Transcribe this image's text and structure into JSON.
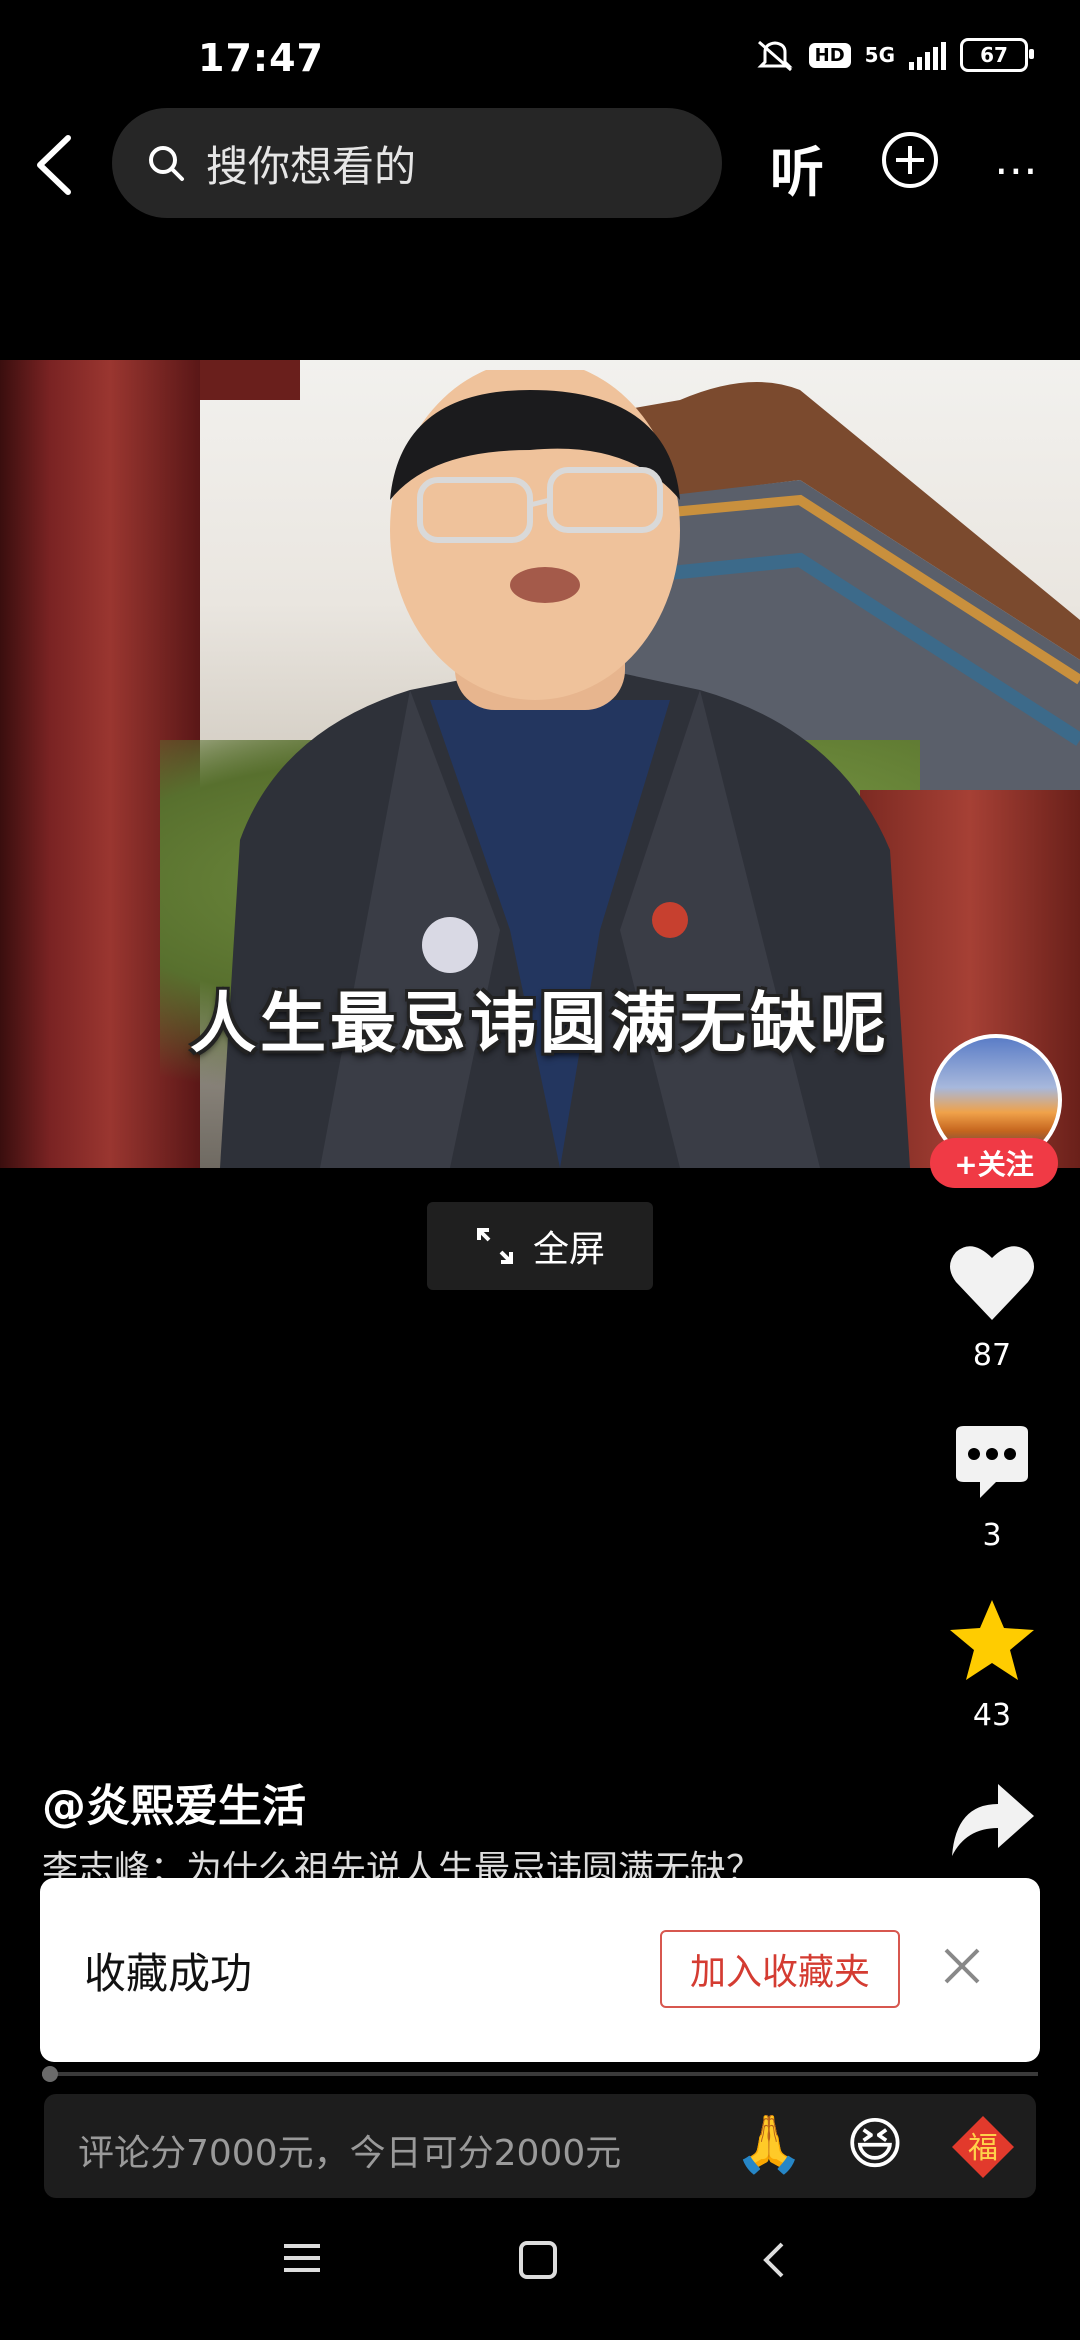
{
  "status": {
    "time": "17:47",
    "network": "5G",
    "hd": "HD",
    "battery": "67"
  },
  "search": {
    "placeholder": "搜你想看的"
  },
  "header": {
    "listen_label": "听"
  },
  "video": {
    "subtitle": "人生最忌讳圆满无缺呢",
    "fullscreen_label": "全屏"
  },
  "creator": {
    "follow_label": "+关注",
    "handle": "@炎熙爱生活"
  },
  "stats": {
    "likes": "87",
    "comments": "3",
    "favorites": "43"
  },
  "description": "李志峰：为什么祖先说人生最忌讳圆满无缺？",
  "toast": {
    "label": "收藏成功",
    "add_to_folder": "加入收藏夹"
  },
  "comment_bar": {
    "placeholder": "评论分7000元，今日可分2000元",
    "emojis": [
      "🙏",
      "😆"
    ],
    "fu_char": "福"
  },
  "colors": {
    "accent_red": "#f03a45",
    "star_yellow": "#ffcc00",
    "toast_button": "#d43c32"
  }
}
